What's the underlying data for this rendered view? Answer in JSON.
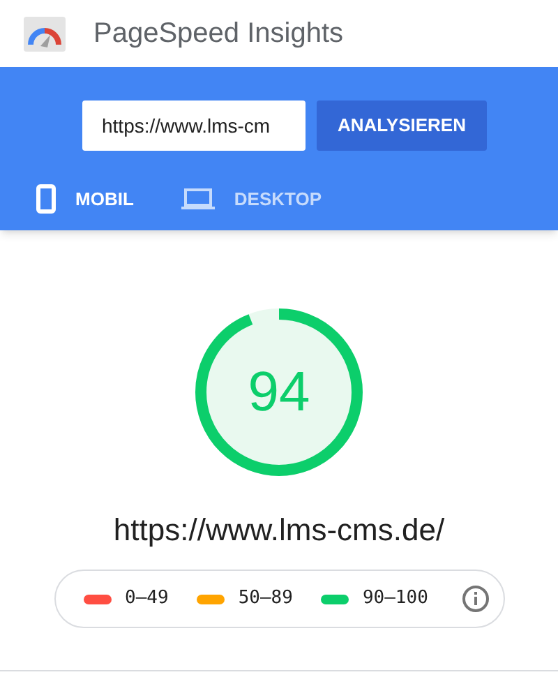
{
  "app": {
    "title": "PageSpeed Insights"
  },
  "search": {
    "value": "https://www.lms-cm",
    "button": "ANALYSIEREN"
  },
  "tabs": [
    {
      "label": "MOBIL",
      "kind": "phone",
      "selected": true
    },
    {
      "label": "DESKTOP",
      "kind": "laptop",
      "selected": false
    }
  ],
  "score": {
    "value": "94",
    "url": "https://www.lms-cms.de/"
  },
  "legend": [
    {
      "label": "0–49",
      "color": "#ff4e42"
    },
    {
      "label": "50–89",
      "color": "#ffa400"
    },
    {
      "label": "90–100",
      "color": "#0cce6b"
    }
  ]
}
